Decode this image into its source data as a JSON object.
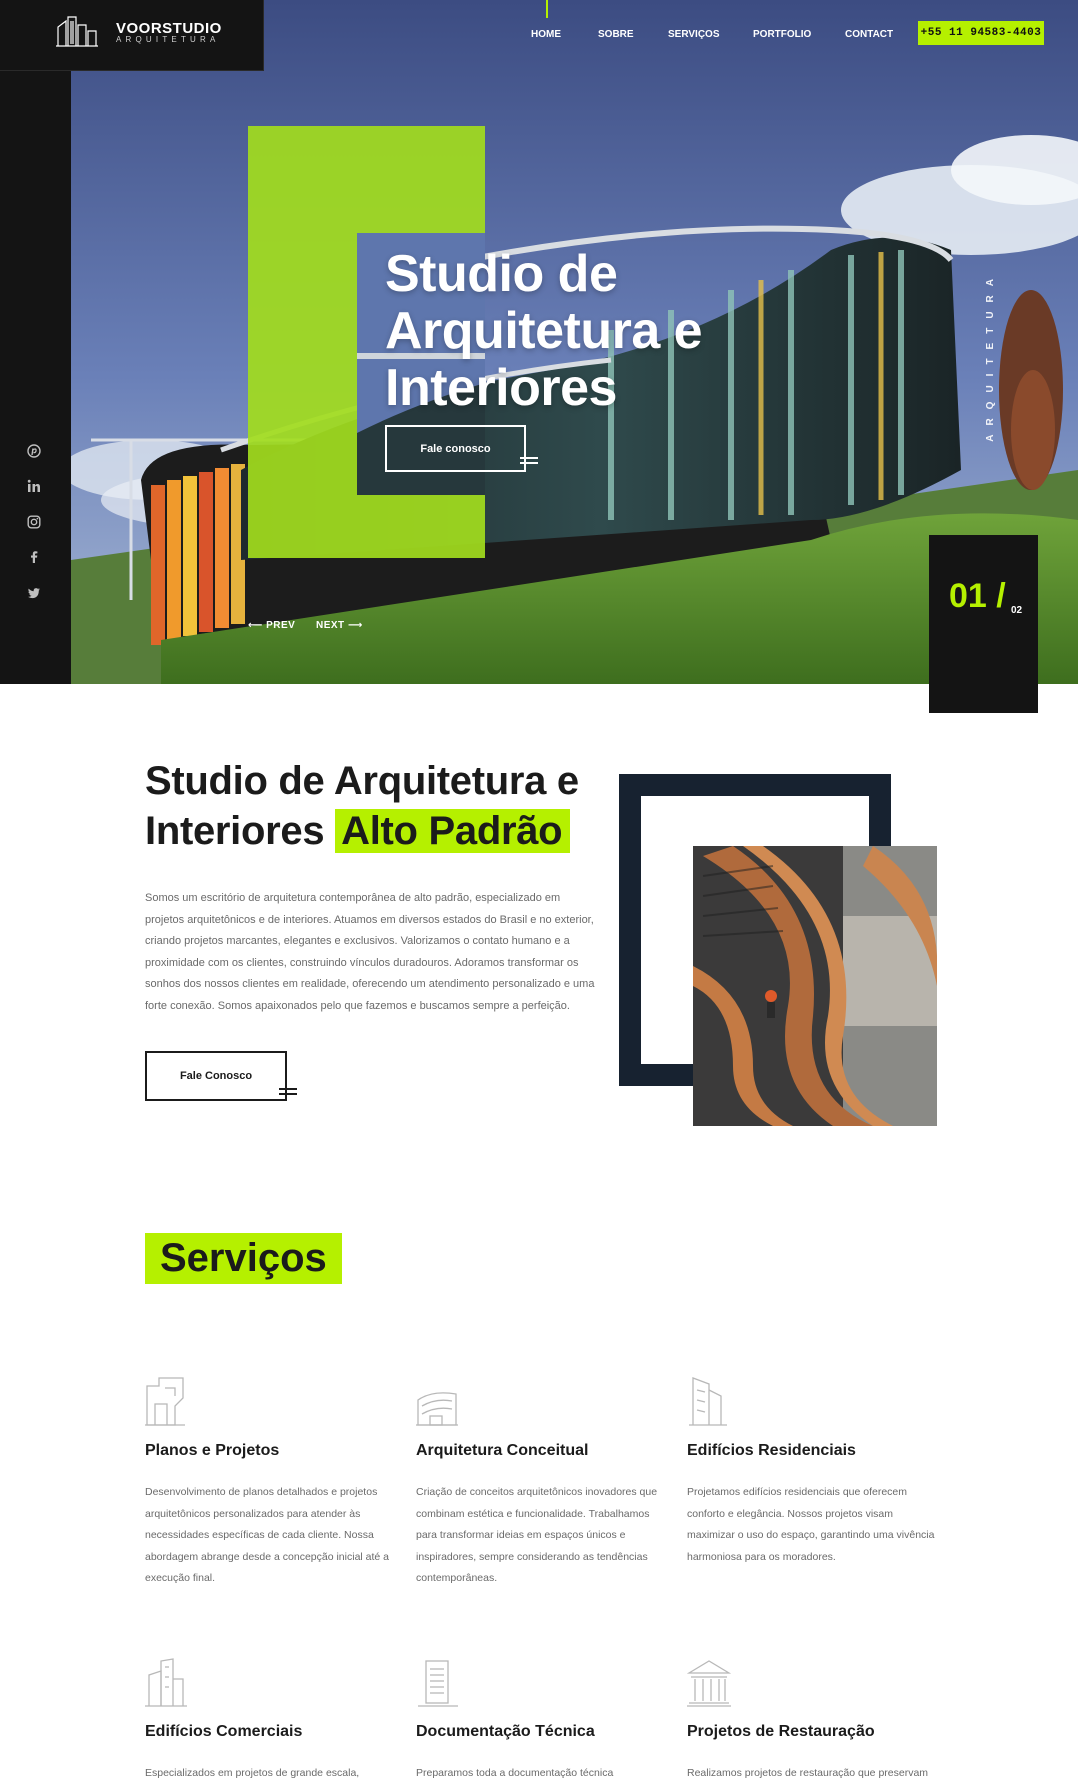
{
  "brand": {
    "name": "VOORSTUDIO",
    "tagline": "ARQUITETURA"
  },
  "nav": {
    "items": [
      {
        "label": "HOME"
      },
      {
        "label": "SOBRE"
      },
      {
        "label": "SERVIÇOS"
      },
      {
        "label": "PORTFOLIO"
      },
      {
        "label": "CONTACT"
      }
    ],
    "phone": "+55 11 94583-4403"
  },
  "social": [
    "pinterest-icon",
    "linkedin-icon",
    "instagram-icon",
    "facebook-icon",
    "twitter-icon"
  ],
  "hero": {
    "title_lines": [
      "Studio de",
      "Arquitetura e",
      "Interiores"
    ],
    "cta": "Fale conosco",
    "prev": "PREV",
    "next": "NEXT",
    "vertical_label": "ARQUITETURA",
    "slide_current": "01 /",
    "slide_total": "02"
  },
  "about": {
    "title_plain": "Studio de Arquitetura e Interiores",
    "title_highlight": "Alto Padrão",
    "text": "Somos um escritório de arquitetura contemporânea de alto padrão, especializado em projetos arquitetônicos e de interiores. Atuamos em diversos estados do Brasil e no exterior, criando projetos marcantes, elegantes e exclusivos. Valorizamos o contato humano e a proximidade com os clientes, construindo vínculos duradouros. Adoramos transformar os sonhos dos nossos clientes em realidade, oferecendo um atendimento personalizado e uma forte conexão. Somos apaixonados pelo que fazemos e buscamos sempre a perfeição.",
    "cta": "Fale Conosco"
  },
  "services": {
    "heading": "Serviços",
    "items": [
      {
        "icon": "floor-plan-icon",
        "title": "Planos e Projetos",
        "text": "Desenvolvimento de planos detalhados e projetos arquitetônicos personalizados para atender às necessidades específicas de cada cliente. Nossa abordagem abrange desde a concepção inicial até a execução final."
      },
      {
        "icon": "concept-building-icon",
        "title": "Arquitetura Conceitual",
        "text": "Criação de conceitos arquitetônicos inovadores que combinam estética e funcionalidade. Trabalhamos para transformar ideias em espaços únicos e inspiradores, sempre considerando as tendências contemporâneas."
      },
      {
        "icon": "residential-building-icon",
        "title": "Edifícios Residenciais",
        "text": "Projetamos edifícios residenciais que oferecem conforto e elegância. Nossos projetos visam maximizar o uso do espaço, garantindo uma vivência harmoniosa para os moradores."
      },
      {
        "icon": "commercial-building-icon",
        "title": "Edifícios Comerciais",
        "text": "Especializados em projetos de grande escala,"
      },
      {
        "icon": "technical-document-icon",
        "title": "Documentação Técnica",
        "text": "Preparamos toda a documentação técnica"
      },
      {
        "icon": "restoration-columns-icon",
        "title": "Projetos de Restauração",
        "text": "Realizamos projetos de restauração que preservam"
      }
    ]
  },
  "colors": {
    "accent": "#b5f000",
    "dark": "#141414",
    "navy": "#172230",
    "text_muted": "#6a6a6a"
  }
}
